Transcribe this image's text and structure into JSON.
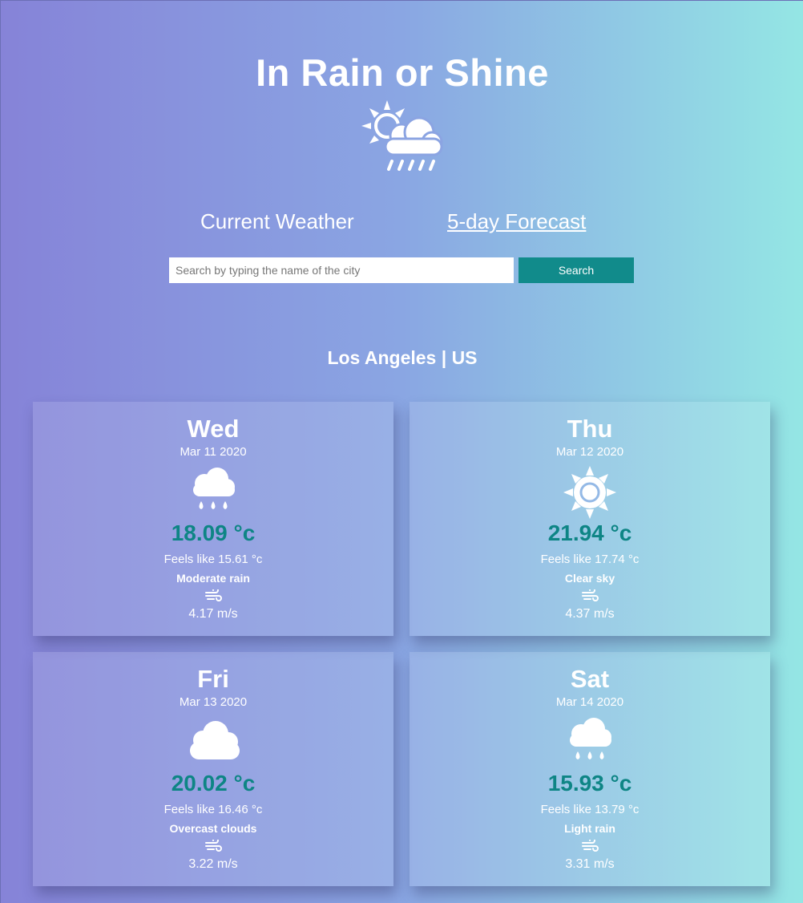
{
  "header": {
    "title": "In Rain or Shine",
    "logo_icon": "sun-cloud-rain-icon"
  },
  "nav": {
    "current_label": "Current Weather",
    "forecast_label": "5-day Forecast"
  },
  "search": {
    "placeholder": "Search by typing the name of the city",
    "value": "",
    "button_label": "Search"
  },
  "location": "Los Angeles | US",
  "colors": {
    "accent": "#118b8b",
    "temp": "#0e8585",
    "gradient_start": "#8683d8",
    "gradient_end": "#94e6e4"
  },
  "forecast": [
    {
      "day": "Wed",
      "date": "Mar 11 2020",
      "icon": "rain-cloud-icon",
      "temp": "18.09 °c",
      "feels": "Feels like 15.61 °c",
      "desc": "Moderate rain",
      "wind_icon": "wind-icon",
      "wind": "4.17 m/s"
    },
    {
      "day": "Thu",
      "date": "Mar 12 2020",
      "icon": "sun-icon",
      "temp": "21.94 °c",
      "feels": "Feels like 17.74 °c",
      "desc": "Clear sky",
      "wind_icon": "wind-icon",
      "wind": "4.37 m/s"
    },
    {
      "day": "Fri",
      "date": "Mar 13 2020",
      "icon": "cloud-icon",
      "temp": "20.02 °c",
      "feels": "Feels like 16.46 °c",
      "desc": "Overcast clouds",
      "wind_icon": "wind-icon",
      "wind": "3.22 m/s"
    },
    {
      "day": "Sat",
      "date": "Mar 14 2020",
      "icon": "rain-cloud-icon",
      "temp": "15.93 °c",
      "feels": "Feels like 13.79 °c",
      "desc": "Light rain",
      "wind_icon": "wind-icon",
      "wind": "3.31 m/s"
    }
  ]
}
